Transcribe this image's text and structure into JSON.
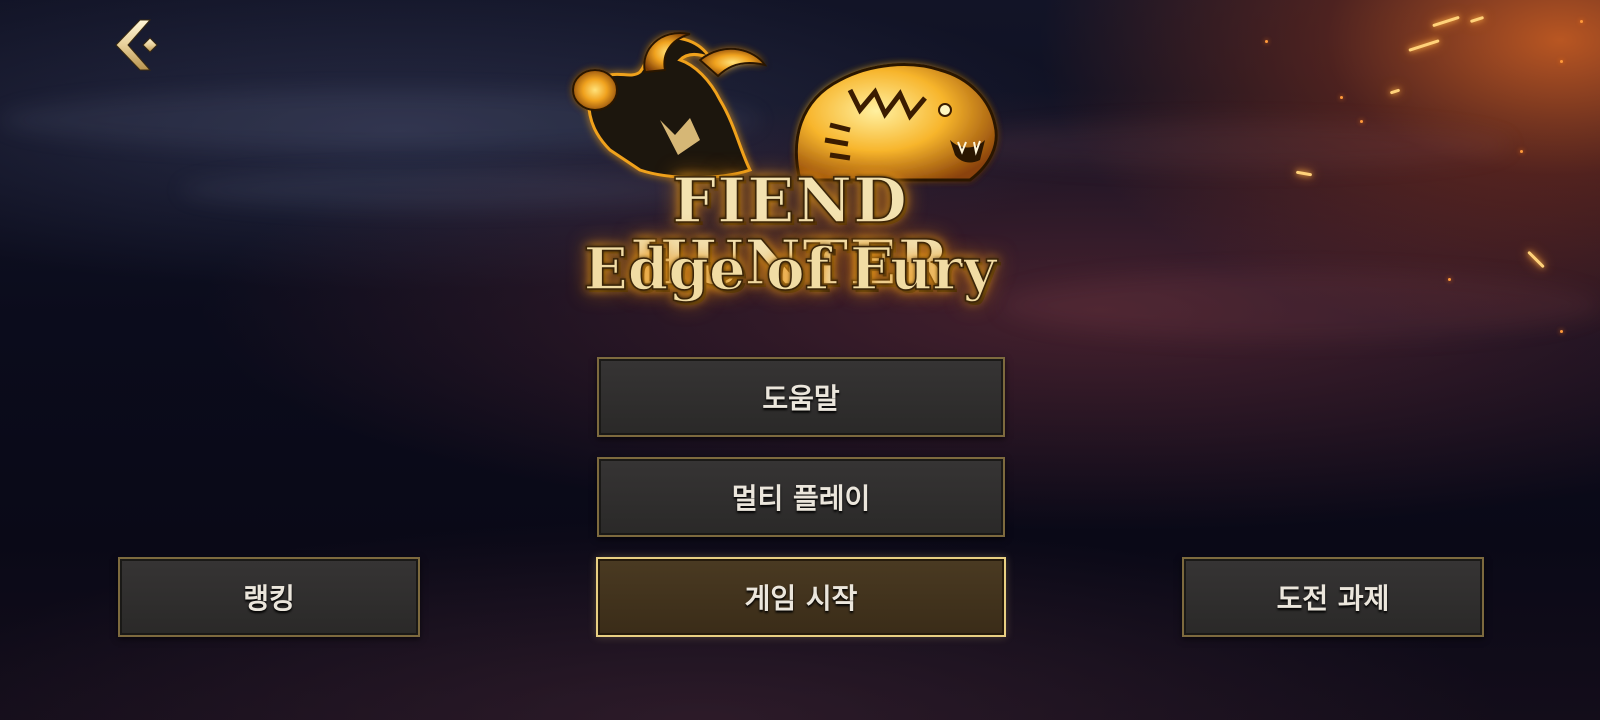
{
  "game": {
    "title": "FIEND HUNTER",
    "subtitle": "Edge of Fury"
  },
  "icons": {
    "back": "chevron-left-icon",
    "logo_art": "tiger-and-demon-emblem"
  },
  "menu": {
    "help": "도움말",
    "multiplayer": "멀티 플레이",
    "start": "게임 시작",
    "ranking": "랭킹",
    "challenges": "도전 과제"
  },
  "colors": {
    "button_border": "#7d6a3e",
    "primary_border": "#e8cf82",
    "button_fill": "#2f2e2d",
    "primary_fill": "#42331d",
    "logo_gold": "#f3e2b0",
    "logo_glow": "#ffb020"
  }
}
